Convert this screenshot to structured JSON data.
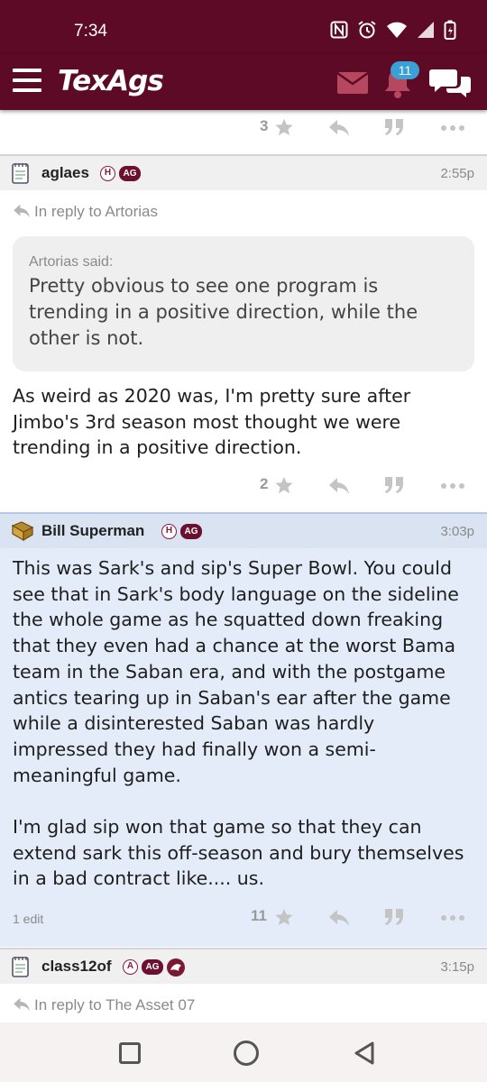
{
  "status_bar": {
    "time": "7:34"
  },
  "app_bar": {
    "logo": "TexAgs",
    "notification_count": "11"
  },
  "posts": [
    {
      "stars": "3"
    },
    {
      "username": "aglaes",
      "badges": [
        "H",
        "AG"
      ],
      "time": "2:55p",
      "reply_to": "In reply to Artorias",
      "quote_author": "Artorias said:",
      "quote_text": "Pretty obvious to see one program is trending in a positive direction, while the other is not.",
      "body": "As weird as 2020 was, I'm pretty sure after Jimbo's 3rd season most thought we were trending in a positive direction.",
      "stars": "2"
    },
    {
      "username": "Bill Superman",
      "badges": [
        "H",
        "AG"
      ],
      "time": "3:03p",
      "body_p1": "This was Sark's and sip's Super Bowl. You could see that in Sark's body language on the sideline the whole game as he squatted down freaking that they even had a chance at the worst Bama team in the Saban era, and with the postgame antics tearing up in Saban's ear after the game while a disinterested Saban was hardly impressed they had finally won a semi-meaningful game.",
      "body_p2": "I'm glad sip won that game so that they can extend sark this off-season and bury themselves in a bad contract like.... us.",
      "edit_note": "1 edit",
      "stars": "11"
    },
    {
      "username": "class12of",
      "badges": [
        "A",
        "AG"
      ],
      "time": "3:15p",
      "reply_to": "In reply to The Asset 07"
    }
  ],
  "colors": {
    "brand": "#5c0a26",
    "highlight": "#e4ecfa",
    "badge": "#3aa0d6"
  },
  "icons": [
    "menu-icon",
    "mail-icon",
    "bell-icon",
    "chat-icon",
    "star-icon",
    "reply-icon",
    "quote-icon",
    "more-icon"
  ]
}
